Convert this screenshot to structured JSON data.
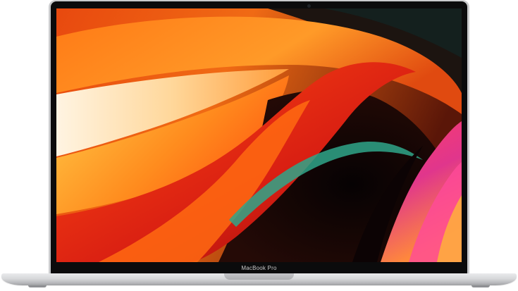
{
  "device": {
    "brand_label": "MacBook Pro",
    "icons": [
      "camera-icon"
    ],
    "colors": {
      "aluminium": "#c9cacc",
      "bezel": "#0b0b0c",
      "wallpaper_orange": "#ff5a10",
      "wallpaper_red": "#d81e12",
      "wallpaper_yellow": "#ffc02a",
      "wallpaper_teal": "#2fa68a",
      "wallpaper_magenta": "#e0368c"
    }
  }
}
